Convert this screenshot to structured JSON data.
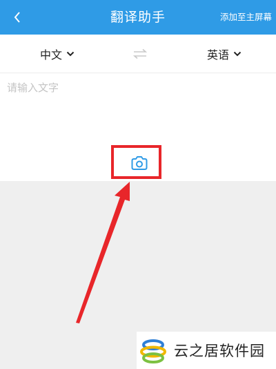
{
  "header": {
    "title": "翻译助手",
    "add_to_home": "添加至主屏幕",
    "bg_color": "#2f9be6"
  },
  "lang": {
    "source": "中文",
    "target": "英语"
  },
  "input": {
    "placeholder": "请输入文字",
    "value": ""
  },
  "camera": {
    "icon": "camera-icon",
    "color": "#2f9be6"
  },
  "annotation": {
    "highlight_color": "#e8262a"
  },
  "watermark": {
    "text": "云之居软件园"
  }
}
